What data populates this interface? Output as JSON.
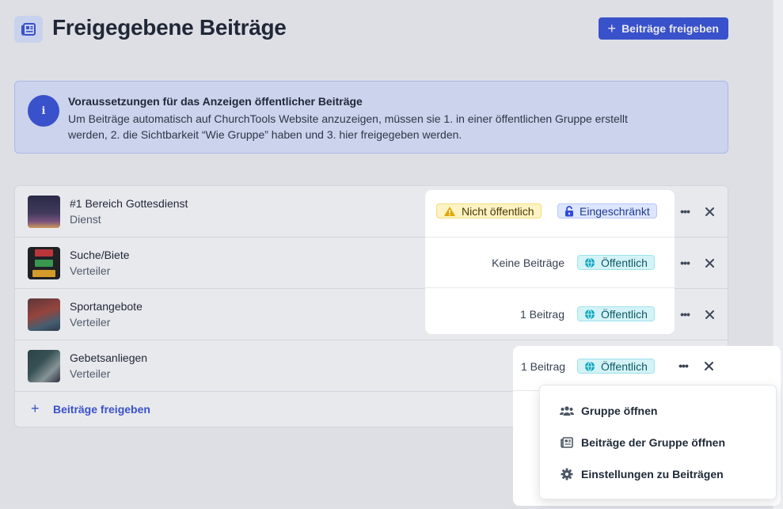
{
  "header": {
    "title": "Freigegebene Beiträge",
    "button_label": "Beiträge freigeben"
  },
  "info": {
    "title": "Voraussetzungen für das Anzeigen öffentlicher Beiträge",
    "line1": "Um Beiträge automatisch auf ChurchTools Website anzuzeigen, müssen sie 1. in einer öffentlichen Gruppe erstellt",
    "line2": "werden, 2. die Sichtbarkeit “Wie Gruppe” haben und 3. hier freigegeben werden."
  },
  "rows": [
    {
      "name": "#1 Bereich Gottesdienst",
      "type": "Dienst",
      "count": "",
      "badge1": "Nicht öffentlich",
      "badge2": "Eingeschränkt"
    },
    {
      "name": "Suche/Biete",
      "type": "Verteiler",
      "count": "Keine Beiträge",
      "badge2": "Öffentlich"
    },
    {
      "name": "Sportangebote",
      "type": "Verteiler",
      "count": "1 Beitrag",
      "badge2": "Öffentlich"
    },
    {
      "name": "Gebetsanliegen",
      "type": "Verteiler",
      "count": "1 Beitrag",
      "badge2": "Öffentlich"
    }
  ],
  "add_row": {
    "label": "Beiträge freigeben"
  },
  "menu": {
    "items": [
      {
        "label": "Gruppe öffnen",
        "icon": "users-icon"
      },
      {
        "label": "Beiträge der Gruppe öffnen",
        "icon": "newspaper-icon"
      },
      {
        "label": "Einstellungen zu Beiträgen",
        "icon": "gear-icon"
      }
    ]
  },
  "colors": {
    "primary": "#2f4ad6",
    "warning_bg": "#fdf3c4",
    "restricted_bg": "#dde5ff",
    "public_bg": "#d4f3f7"
  }
}
